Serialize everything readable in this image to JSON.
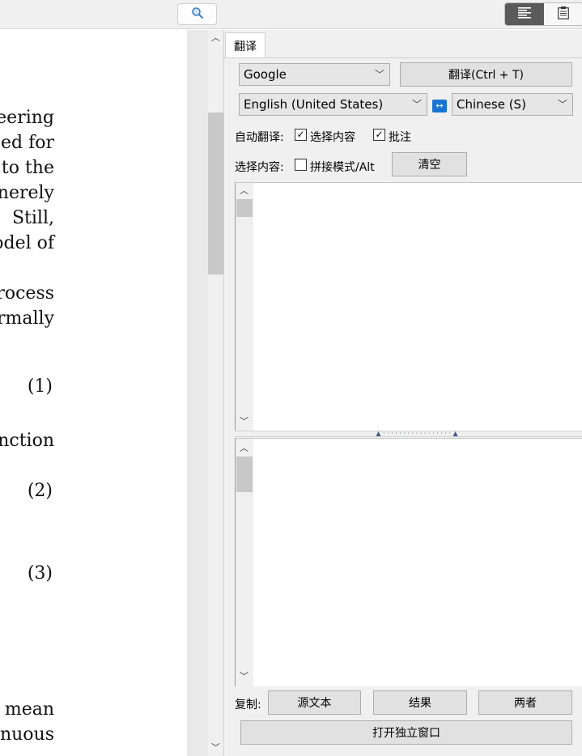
{
  "toolbar": {
    "search_icon": "magnifier-icon",
    "view_modes": [
      "text-view-icon",
      "note-view-icon"
    ]
  },
  "document": {
    "lines": [
      "eering",
      "ed for",
      "to the",
      "nerely",
      "Still,",
      "odel of",
      "rocess",
      "rmally",
      "(1)",
      "nction",
      "(2)",
      "(3)",
      "mean",
      "inuous"
    ]
  },
  "panel": {
    "tab_label": "翻译",
    "engine": "Google",
    "translate_button": "翻译(Ctrl + T)",
    "source_lang": "English (United States)",
    "swap_icon": "swap-arrows-icon",
    "target_lang": "Chinese (S)",
    "auto_translate_label": "自动翻译:",
    "auto_selection_label": "选择内容",
    "auto_selection_checked": true,
    "auto_annotation_label": "批注",
    "auto_annotation_checked": true,
    "selection_label": "选择内容:",
    "concat_mode_label": "拼接模式/Alt",
    "concat_mode_checked": false,
    "clear_button": "清空",
    "source_text": "",
    "result_text": "",
    "copy_label": "复制:",
    "copy_source_button": "源文本",
    "copy_result_button": "结果",
    "copy_both_button": "两者",
    "open_window_button": "打开独立窗口"
  },
  "colors": {
    "accent": "#1874d2",
    "toolbar_bg": "#f0f0f0",
    "button_bg": "#e1e1e1",
    "active_toggle": "#5a5a5a"
  }
}
